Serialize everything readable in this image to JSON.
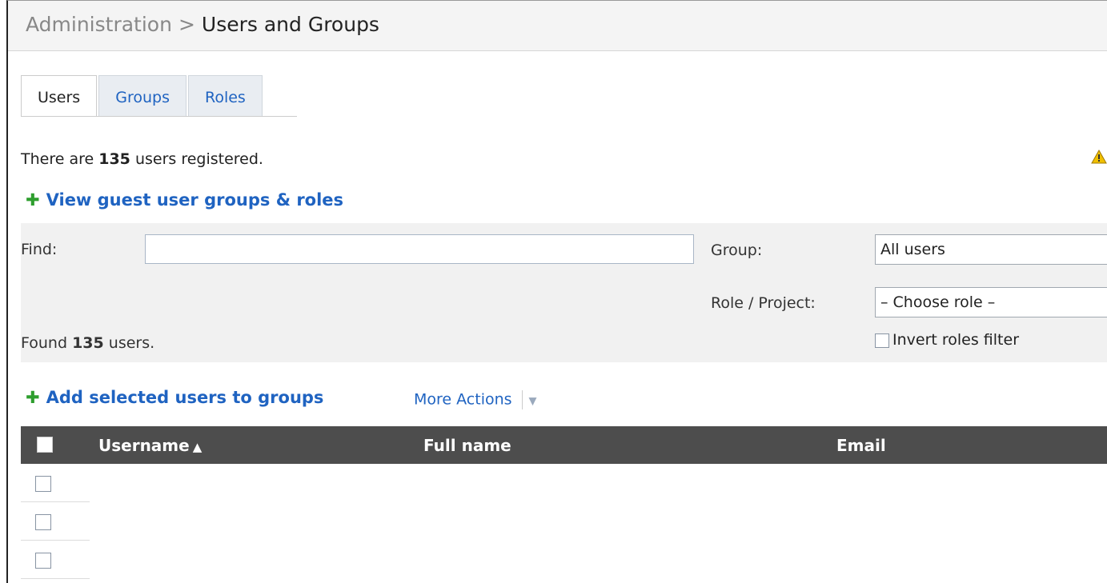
{
  "breadcrumb": {
    "parent": "Administration",
    "separator": ">",
    "current": "Users and Groups"
  },
  "tabs": [
    {
      "label": "Users",
      "active": true
    },
    {
      "label": "Groups",
      "active": false
    },
    {
      "label": "Roles",
      "active": false
    }
  ],
  "summary": {
    "prefix": "There are ",
    "count": "135",
    "suffix": " users registered."
  },
  "guest_link": {
    "icon": "plus-icon",
    "label": "View guest user groups & roles"
  },
  "warning_icon": "warning-icon",
  "filter": {
    "find_label": "Find:",
    "find_value": "",
    "group_label": "Group:",
    "group_value": "All users",
    "role_label": "Role / Project:",
    "role_value": "– Choose role –",
    "invert_label": "Invert roles filter",
    "found_prefix": "Found ",
    "found_count": "135",
    "found_suffix": " users."
  },
  "actions": {
    "add_label": "Add selected users to groups",
    "more_label": "More Actions"
  },
  "table": {
    "columns": [
      "Username",
      "Full name",
      "Email"
    ],
    "sort_indicator": "▲",
    "rows": [
      {
        "username": "",
        "full_name": "",
        "email": ""
      },
      {
        "username": "",
        "full_name": "",
        "email": ""
      },
      {
        "username": "",
        "full_name": "",
        "email": ""
      }
    ]
  },
  "colors": {
    "link": "#1f63c1",
    "table_header": "#4d4d4d",
    "plus": "#2e9e2e",
    "warning": "#f0c000"
  }
}
